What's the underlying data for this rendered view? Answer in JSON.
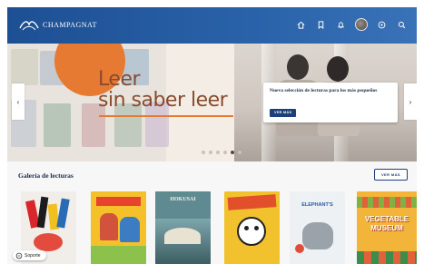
{
  "header": {
    "logo_text": "CHAMPAGNAT",
    "logo_subtext": "",
    "nav_icons": [
      "home-icon",
      "bookmark-icon",
      "notification-icon",
      "avatar",
      "help-icon",
      "search-icon"
    ]
  },
  "hero": {
    "headline_line1": "Leer",
    "headline_line2": "sin saber leer",
    "card_title": "Nueva selección de lecturas para los más pequeños",
    "card_button": "VER MÁS",
    "slides_total": 6,
    "active_slide": 5
  },
  "gallery": {
    "title": "Galería de lecturas",
    "button": "VER MÁS",
    "books": [
      {
        "name": "book-cover-1"
      },
      {
        "name": "book-cover-2"
      },
      {
        "name": "book-cover-3",
        "cover_text": "HOKUSAI"
      },
      {
        "name": "book-cover-4"
      },
      {
        "name": "book-cover-5",
        "cover_text": "ELEPHANT'S"
      },
      {
        "name": "book-cover-6",
        "cover_text": "VEGETABLE MUSEUM"
      }
    ]
  },
  "support": {
    "label": "Soporte"
  },
  "colors": {
    "header_blue": "#1d4f93",
    "accent_orange": "#e77a32",
    "headline_brown": "#8a4a2c",
    "button_navy": "#1d3f7a"
  }
}
